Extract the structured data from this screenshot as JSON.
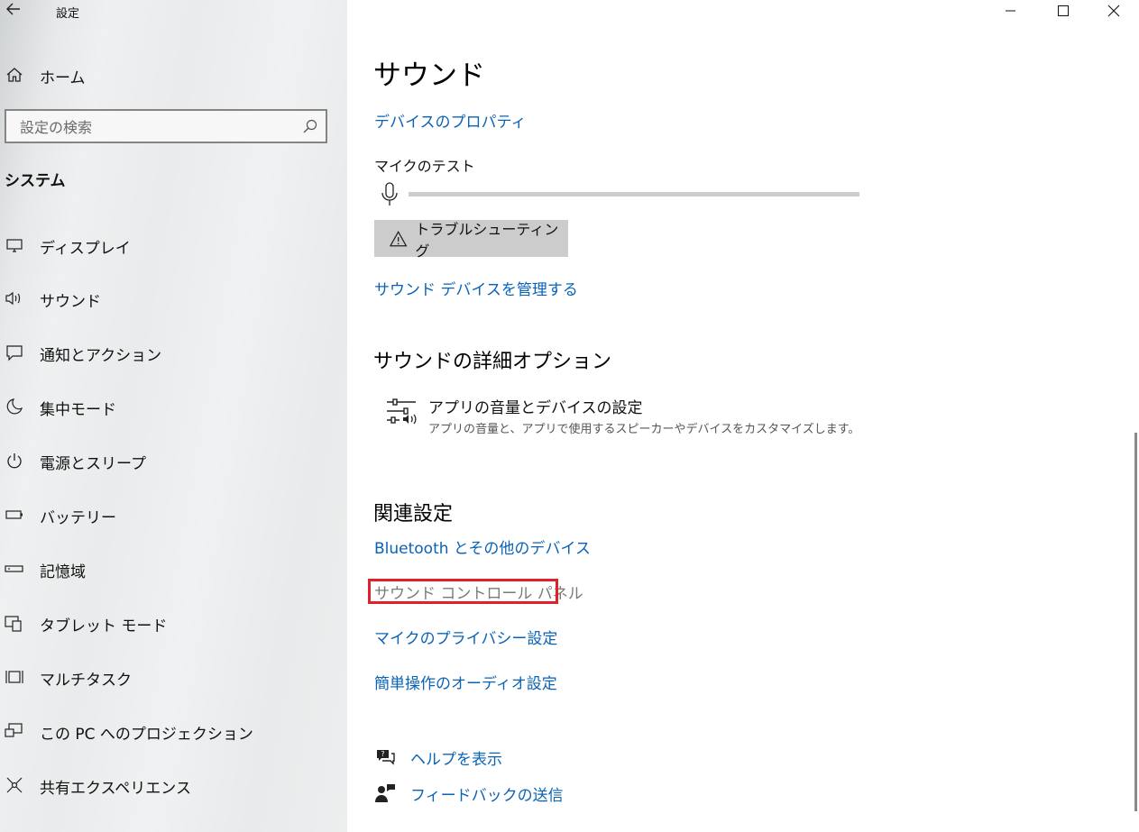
{
  "window": {
    "title": "設定",
    "controls": {
      "minimize": "minimize-icon",
      "maximize": "maximize-icon",
      "close": "close-icon"
    }
  },
  "sidebar": {
    "home_label": "ホーム",
    "search_placeholder": "設定の検索",
    "section_title": "システム",
    "items": [
      {
        "label": "ディスプレイ",
        "icon": "display-icon"
      },
      {
        "label": "サウンド",
        "icon": "speaker-icon"
      },
      {
        "label": "通知とアクション",
        "icon": "notification-icon"
      },
      {
        "label": "集中モード",
        "icon": "moon-icon"
      },
      {
        "label": "電源とスリープ",
        "icon": "power-icon"
      },
      {
        "label": "バッテリー",
        "icon": "battery-icon"
      },
      {
        "label": "記憶域",
        "icon": "storage-icon"
      },
      {
        "label": "タブレット モード",
        "icon": "tablet-icon"
      },
      {
        "label": "マルチタスク",
        "icon": "multitask-icon"
      },
      {
        "label": "この PC へのプロジェクション",
        "icon": "projection-icon"
      },
      {
        "label": "共有エクスペリエンス",
        "icon": "share-icon"
      }
    ]
  },
  "main": {
    "title": "サウンド",
    "device_properties_link": "デバイスのプロパティ",
    "mic_test_label": "マイクのテスト",
    "mic_level": 0,
    "troubleshoot_button": "トラブルシューティング",
    "manage_devices_link": "サウンド デバイスを管理する",
    "advanced": {
      "heading": "サウンドの詳細オプション",
      "app_volume_title": "アプリの音量とデバイスの設定",
      "app_volume_desc": "アプリの音量と、アプリで使用するスピーカーやデバイスをカスタマイズします。"
    },
    "related": {
      "heading": "関連設定",
      "links": [
        "Bluetooth とその他のデバイス",
        "サウンド コントロール パネル",
        "マイクのプライバシー設定",
        "簡単操作のオーディオ設定"
      ]
    },
    "help": {
      "get_help": "ヘルプを表示",
      "feedback": "フィードバックの送信"
    }
  },
  "colors": {
    "link": "#0a63b7",
    "highlight_border": "#e0202a",
    "button_bg": "#cccccc"
  }
}
